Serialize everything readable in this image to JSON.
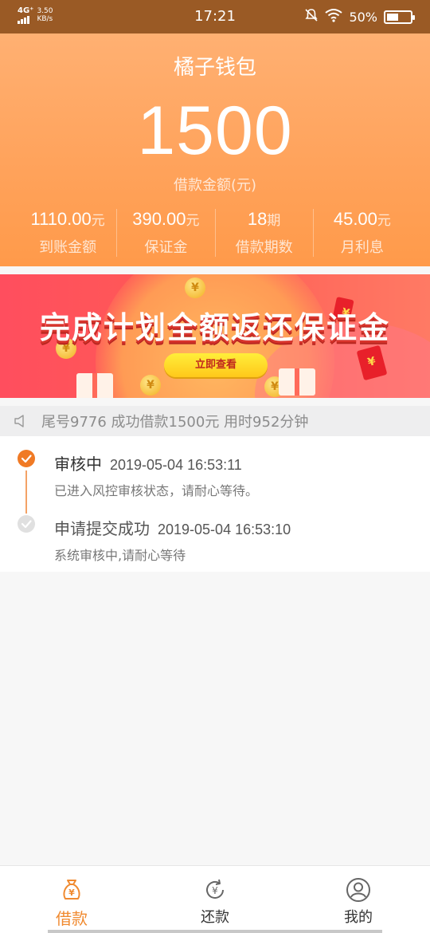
{
  "status_bar": {
    "network": "4G⁺",
    "speed_value": "3.50",
    "speed_unit": "KB/s",
    "time": "17:21",
    "battery": "50%",
    "battery_level": 0.5
  },
  "header": {
    "title": "橘子钱包",
    "amount": "1500",
    "amount_label": "借款金额(元)"
  },
  "stats": [
    {
      "value": "1110.00",
      "unit": "元",
      "label": "到账金额"
    },
    {
      "value": "390.00",
      "unit": "元",
      "label": "保证金"
    },
    {
      "value": "18",
      "unit": "期",
      "label": "借款期数"
    },
    {
      "value": "45.00",
      "unit": "元",
      "label": "月利息"
    }
  ],
  "banner": {
    "headline": "完成计划全额返还保证金",
    "button_label": "立即查看"
  },
  "notice": {
    "text": "尾号9776 成功借款1500元 用时952分钟"
  },
  "steps": [
    {
      "title": "审核中",
      "time": "2019-05-04 16:53:11",
      "desc": "已进入风控审核状态，请耐心等待。",
      "status": "active"
    },
    {
      "title": "申请提交成功",
      "time": "2019-05-04 16:53:10",
      "desc": "系统审核中,请耐心等待",
      "status": "done"
    }
  ],
  "tabbar": {
    "items": [
      {
        "label": "借款",
        "icon": "money-bag-icon",
        "active": true
      },
      {
        "label": "还款",
        "icon": "refresh-yen-icon",
        "active": false
      },
      {
        "label": "我的",
        "icon": "user-icon",
        "active": false
      }
    ]
  },
  "colors": {
    "accent": "#f08a30",
    "status_bar": "#9a5a25",
    "hero_top": "#ffb072",
    "hero_bottom": "#ff9a4a"
  }
}
